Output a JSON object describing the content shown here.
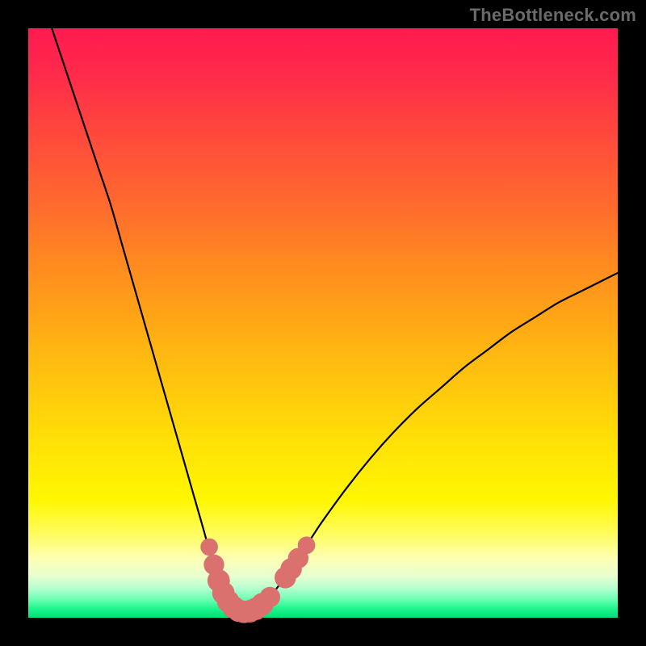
{
  "watermark": "TheBottleneck.com",
  "chart_data": {
    "type": "line",
    "title": "",
    "xlabel": "",
    "ylabel": "",
    "xlim": [
      0,
      100
    ],
    "ylim": [
      0,
      100
    ],
    "series": [
      {
        "name": "bottleneck-curve",
        "x": [
          4,
          6,
          8,
          10,
          12,
          14,
          16,
          18,
          20,
          22,
          24,
          26,
          28,
          30,
          31,
          32,
          33,
          34,
          35,
          36,
          37,
          38,
          39,
          40,
          42,
          44,
          46,
          48,
          50,
          54,
          58,
          62,
          66,
          70,
          74,
          78,
          82,
          86,
          90,
          94,
          98,
          100
        ],
        "y": [
          100,
          94,
          88,
          82,
          76,
          70,
          63,
          56,
          49,
          42,
          35,
          28,
          21,
          14,
          10,
          7,
          4.5,
          2.8,
          1.8,
          1.2,
          1.0,
          1.2,
          1.8,
          2.6,
          4.8,
          7.5,
          10.5,
          13.5,
          16.5,
          22.0,
          27.0,
          31.5,
          35.5,
          39.0,
          42.5,
          45.5,
          48.5,
          51.0,
          53.5,
          55.5,
          57.5,
          58.5
        ]
      }
    ],
    "markers": {
      "name": "highlighted-points",
      "color": "#da716f",
      "points": [
        {
          "x": 30.7,
          "y": 12.0,
          "r": 1.1
        },
        {
          "x": 31.5,
          "y": 9.0,
          "r": 1.4
        },
        {
          "x": 32.3,
          "y": 6.3,
          "r": 1.6
        },
        {
          "x": 33.1,
          "y": 4.2,
          "r": 1.6
        },
        {
          "x": 33.9,
          "y": 2.8,
          "r": 1.6
        },
        {
          "x": 34.8,
          "y": 1.8,
          "r": 1.6
        },
        {
          "x": 35.7,
          "y": 1.2,
          "r": 1.6
        },
        {
          "x": 36.6,
          "y": 1.0,
          "r": 1.6
        },
        {
          "x": 37.6,
          "y": 1.1,
          "r": 1.6
        },
        {
          "x": 38.6,
          "y": 1.5,
          "r": 1.6
        },
        {
          "x": 39.7,
          "y": 2.3,
          "r": 1.6
        },
        {
          "x": 41.0,
          "y": 3.5,
          "r": 1.4
        },
        {
          "x": 43.6,
          "y": 6.8,
          "r": 1.5
        },
        {
          "x": 44.6,
          "y": 8.3,
          "r": 1.5
        },
        {
          "x": 45.8,
          "y": 10.1,
          "r": 1.4
        },
        {
          "x": 47.2,
          "y": 12.3,
          "r": 1.1
        }
      ]
    }
  }
}
